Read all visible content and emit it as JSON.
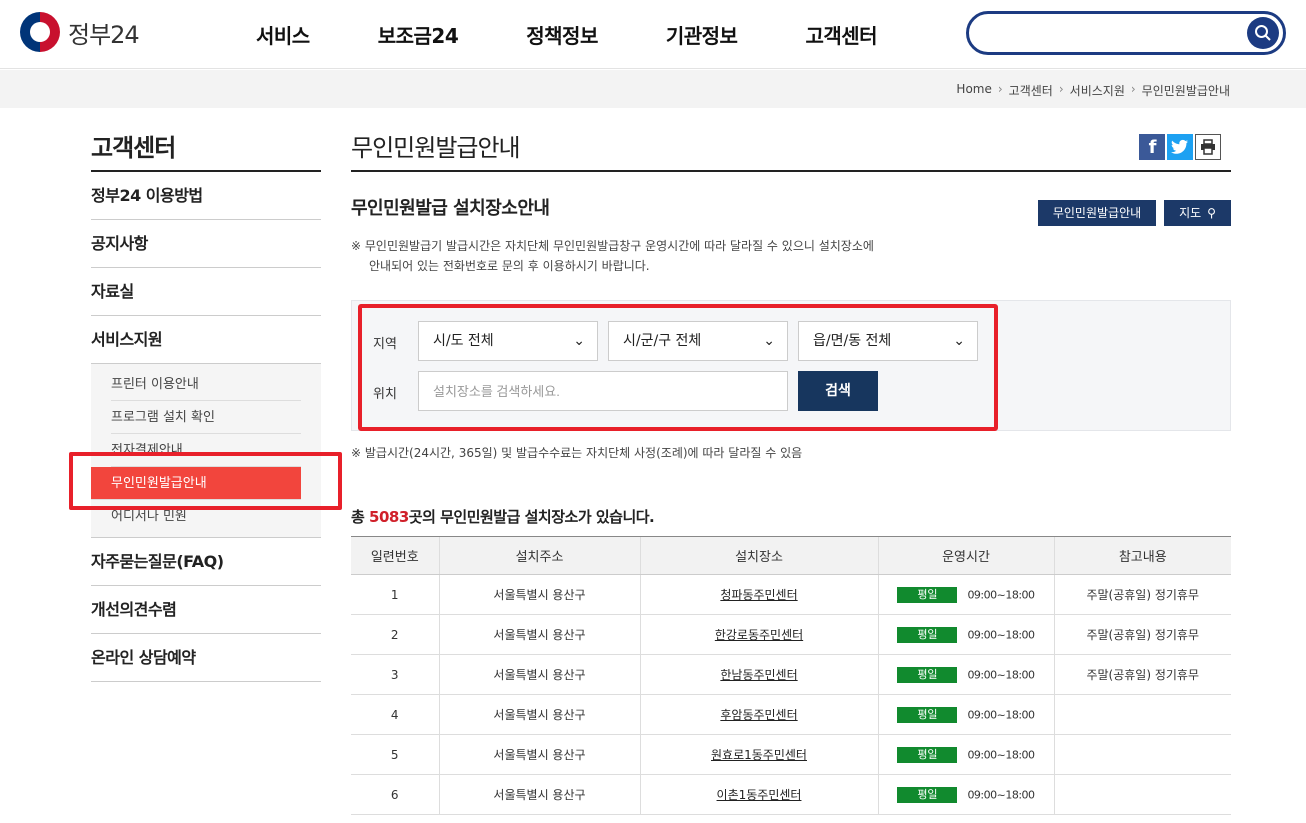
{
  "header": {
    "logo_text": "정부24",
    "nav": [
      "서비스",
      "보조금24",
      "정책정보",
      "기관정보",
      "고객센터"
    ],
    "search_placeholder": ""
  },
  "breadcrumb": [
    "Home",
    "고객센터",
    "서비스지원",
    "무인민원발급안내"
  ],
  "sidebar": {
    "title": "고객센터",
    "items_top": [
      "정부24 이용방법",
      "공지사항",
      "자료실",
      "서비스지원"
    ],
    "sub_items": [
      "프린터 이용안내",
      "프로그램 설치 확인",
      "전자결제안내",
      "무인민원발급안내",
      "어디서나 민원"
    ],
    "items_bottom": [
      "자주묻는질문(FAQ)",
      "개선의견수렴",
      "온라인 상담예약"
    ]
  },
  "main": {
    "page_title": "무인민원발급안내",
    "sub_title": "무인민원발급 설치장소안내",
    "btn_info": "무인민원발급안내",
    "btn_map": "지도",
    "notice_line1": "※ 무인민원발급기 발급시간은 자치단체 무인민원발급창구 운영시간에 따라 달라질 수 있으니 설치장소에",
    "notice_line2": "안내되어 있는 전화번호로 문의 후 이용하시기 바랍니다.",
    "search": {
      "region_label": "지역",
      "location_label": "위치",
      "sido": "시/도 전체",
      "sigungu": "시/군/구 전체",
      "eupmyeondong": "읍/면/동 전체",
      "placeholder": "설치장소를 검색하세요.",
      "submit": "검색"
    },
    "notice2": "※ 발급시간(24시간, 365일) 및 발급수수료는 자치단체 사정(조례)에 따라 달라질 수 있음",
    "count_prefix": "총 ",
    "count": "5083",
    "count_suffix": "곳의 무인민원발급 설치장소가 있습니다.",
    "table": {
      "headers": [
        "일련번호",
        "설치주소",
        "설치장소",
        "운영시간",
        "참고내용"
      ],
      "rows": [
        {
          "no": "1",
          "addr": "서울특별시 용산구",
          "place": "청파동주민센터",
          "badge": "평일",
          "hours": "09:00~18:00",
          "note": "주말(공휴일) 정기휴무"
        },
        {
          "no": "2",
          "addr": "서울특별시 용산구",
          "place": "한강로동주민센터",
          "badge": "평일",
          "hours": "09:00~18:00",
          "note": "주말(공휴일) 정기휴무"
        },
        {
          "no": "3",
          "addr": "서울특별시 용산구",
          "place": "한남동주민센터",
          "badge": "평일",
          "hours": "09:00~18:00",
          "note": "주말(공휴일) 정기휴무"
        },
        {
          "no": "4",
          "addr": "서울특별시 용산구",
          "place": "후암동주민센터",
          "badge": "평일",
          "hours": "09:00~18:00",
          "note": ""
        },
        {
          "no": "5",
          "addr": "서울특별시 용산구",
          "place": "원효로1동주민센터",
          "badge": "평일",
          "hours": "09:00~18:00",
          "note": ""
        },
        {
          "no": "6",
          "addr": "서울특별시 용산구",
          "place": "이촌1동주민센터",
          "badge": "평일",
          "hours": "09:00~18:00",
          "note": ""
        }
      ]
    }
  },
  "colors": {
    "brand_navy": "#1c3968",
    "active_red": "#f2453d",
    "highlight_red": "#e8202a",
    "badge_green": "#118a2e"
  }
}
